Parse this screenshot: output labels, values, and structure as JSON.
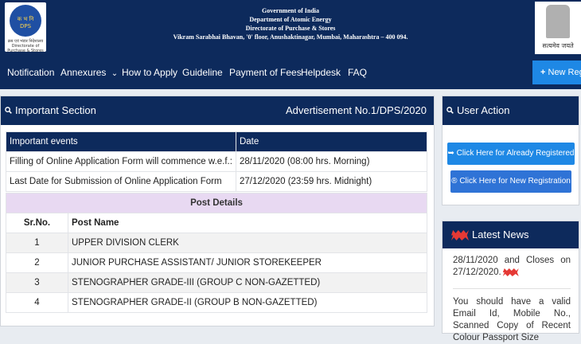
{
  "header": {
    "line1": "Government of India",
    "line2": "Department of Atomic Energy",
    "line3": "Directorate of Purchase & Stores",
    "line4": "Vikram Sarabhai Bhavan, '0' floor, Anushaktinagar, Mumbai, Maharashtra – 400 094.",
    "logo_left_text": "क भ नि\nDPS",
    "logo_left_caption": "क्रय एवं भंडार निदेशालय\nDirectorate of Purchase & Stores",
    "emblem_motto": "सत्यमेव जयते"
  },
  "nav": {
    "items": [
      "Notification",
      "Annexures",
      "How to Apply",
      "Guideline",
      "Payment of Fees",
      "Helpdesk",
      "FAQ"
    ],
    "annexures_caret": "⌄",
    "new_registration": "New Reg",
    "new_registration_icon": "+"
  },
  "important": {
    "title": "Important Section",
    "advertisement": "Advertisement No.1/DPS/2020",
    "col_event": "Important events",
    "col_date": "Date",
    "rows": [
      {
        "event": "Filling of Online Application Form will commence w.e.f.:",
        "date": "28/11/2020 (08:00 hrs. Morning)"
      },
      {
        "event": "Last Date for Submission of Online Application Form",
        "date": "27/12/2020 (23:59 hrs. Midnight)"
      }
    ],
    "post_details_title": "Post Details",
    "col_srno": "Sr.No.",
    "col_postname": "Post Name",
    "posts": [
      {
        "sr": "1",
        "name": "UPPER DIVISION CLERK"
      },
      {
        "sr": "2",
        "name": "JUNIOR PURCHASE ASSISTANT/ JUNIOR STOREKEEPER"
      },
      {
        "sr": "3",
        "name": "STENOGRAPHER GRADE-III (GROUP C NON-GAZETTED)"
      },
      {
        "sr": "4",
        "name": "STENOGRAPHER GRADE-II (GROUP B NON-GAZETTED)"
      }
    ]
  },
  "user_action": {
    "title": "User Action",
    "registered_button": "Click Here for Already Registered",
    "new_registration_button": "Click Here for New Registration"
  },
  "news": {
    "title": "Latest News",
    "item1": "28/11/2020 and Closes on 27/12/2020.",
    "item2": "You should have a valid Email Id, Mobile No., Scanned Copy of Recent Colour Passport Size"
  },
  "colors": {
    "navy": "#0d2a5c",
    "button_blue": "#1e88e5",
    "post_header_bg": "#e8d9f2",
    "badge_red": "#e53935"
  }
}
